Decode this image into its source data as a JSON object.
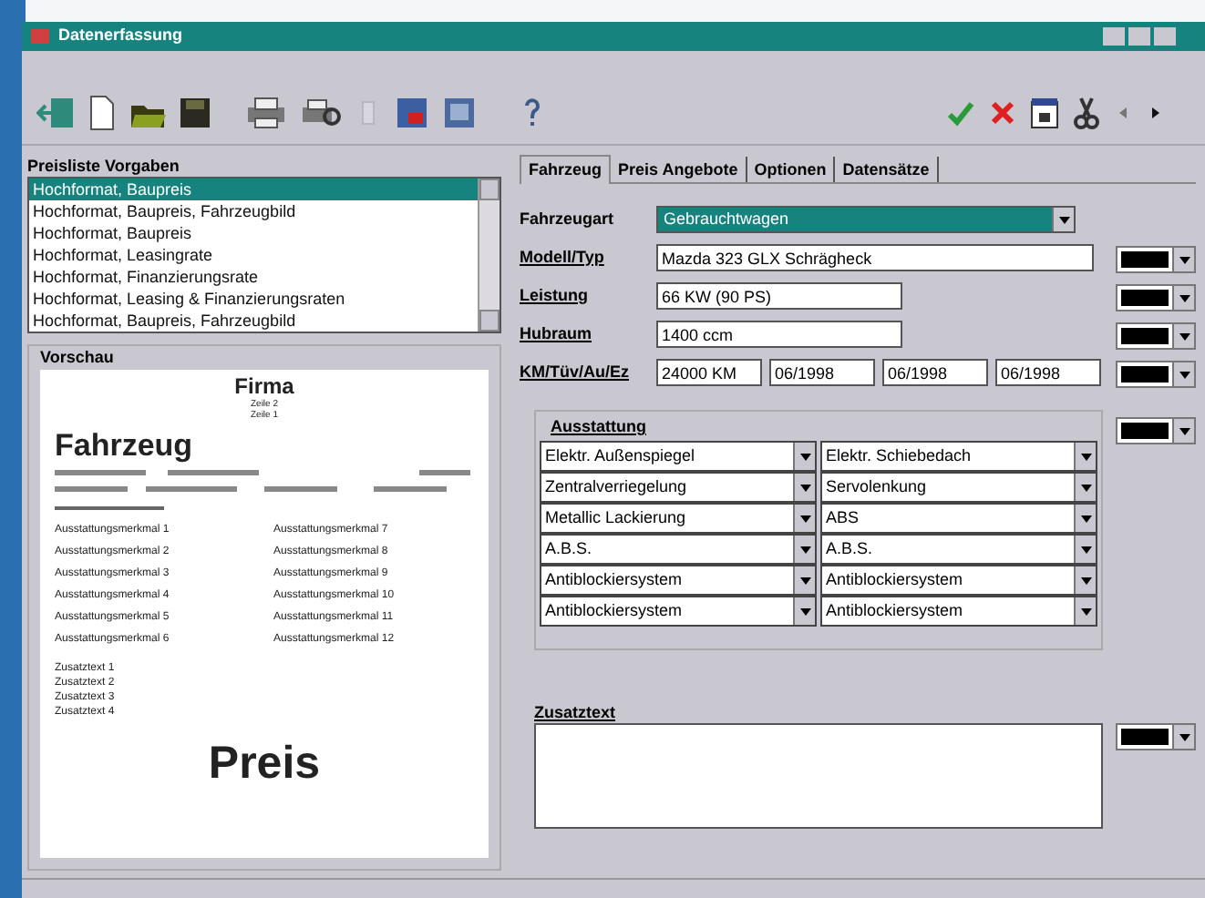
{
  "window": {
    "title": "Datenerfassung"
  },
  "presets": {
    "label": "Preisliste Vorgaben",
    "items": [
      {
        "text": "Hochformat, Baupreis",
        "selected": true
      },
      {
        "text": "Hochformat, Baupreis, Fahrzeugbild",
        "selected": false
      },
      {
        "text": "Hochformat, Baupreis",
        "selected": false
      },
      {
        "text": "Hochformat, Leasingrate",
        "selected": false
      },
      {
        "text": "Hochformat, Finanzierungsrate",
        "selected": false
      },
      {
        "text": "Hochformat, Leasing & Finanzierungsraten",
        "selected": false
      },
      {
        "text": "Hochformat, Baupreis, Fahrzeugbild",
        "selected": false
      }
    ]
  },
  "preview": {
    "label": "Vorschau",
    "company": "Firma",
    "company_lines": [
      "Zeile 2",
      "Zeile 1"
    ],
    "vehicle": "Fahrzeug",
    "equipment_left": [
      "Ausstattungsmerkmal 1",
      "Ausstattungsmerkmal 2",
      "Ausstattungsmerkmal 3",
      "Ausstattungsmerkmal 4",
      "Ausstattungsmerkmal 5",
      "Ausstattungsmerkmal 6"
    ],
    "equipment_right": [
      "Ausstattungsmerkmal 7",
      "Ausstattungsmerkmal 8",
      "Ausstattungsmerkmal 9",
      "Ausstattungsmerkmal 10",
      "Ausstattungsmerkmal 11",
      "Ausstattungsmerkmal 12"
    ],
    "extras": [
      "Zusatztext 1",
      "Zusatztext 2",
      "Zusatztext 3",
      "Zusatztext 4"
    ],
    "price": "Preis"
  },
  "tabs": [
    {
      "label": "Fahrzeug",
      "selected": true
    },
    {
      "label": "Preis Angebote",
      "selected": false
    },
    {
      "label": "Optionen",
      "selected": false
    },
    {
      "label": "Datensätze",
      "selected": false
    }
  ],
  "vehicle_type": {
    "label": "Fahrzeugart",
    "value": "Gebrauchtwagen",
    "highlighted": true
  },
  "fields": [
    {
      "label": "Modell/Typ",
      "values": [
        "Mazda 323 GLX Schrägheck"
      ]
    },
    {
      "label": "Leistung",
      "values": [
        "66 KW (90 PS)"
      ]
    },
    {
      "label": "Hubraum",
      "values": [
        "1400 ccm"
      ]
    },
    {
      "label": "KM/Tüv/Au/Ez",
      "values": [
        "24000 KM",
        "06/1998",
        "06/1998",
        "06/1998"
      ]
    }
  ],
  "equipment": {
    "label": "Ausstattung",
    "items": [
      "Elektr. Außenspiegel",
      "Elektr. Schiebedach",
      "Zentralverriegelung",
      "Servolenkung",
      "Metallic Lackierung",
      "ABS",
      "A.B.S.",
      "A.B.S.",
      "Antiblockiersystem",
      "Antiblockiersystem",
      "Antiblockiersystem",
      "Antiblockiersystem"
    ]
  },
  "extra_text": {
    "label": "Zusatztext"
  }
}
